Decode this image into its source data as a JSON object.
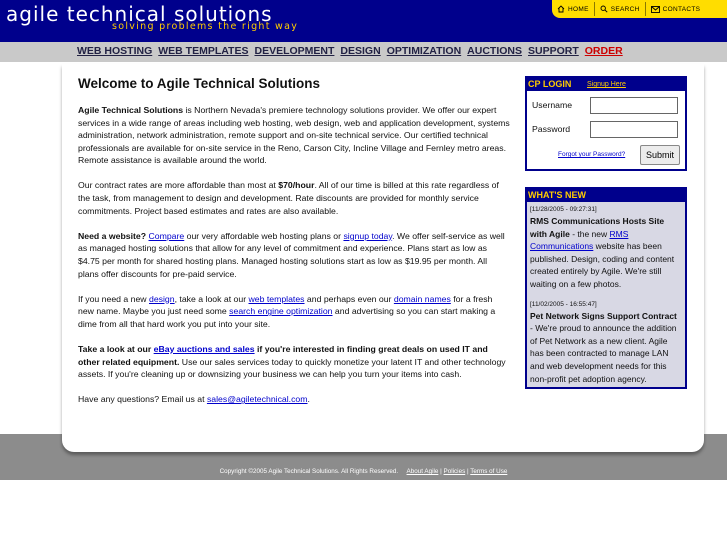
{
  "header": {
    "title": "agile technical solutions",
    "tagline": "solving problems the right way",
    "toplinks": [
      {
        "label": "Home",
        "icon": "home-icon"
      },
      {
        "label": "Search",
        "icon": "search-icon"
      },
      {
        "label": "Contacts",
        "icon": "mail-icon"
      }
    ]
  },
  "nav": [
    "WEB HOSTING",
    "WEB TEMPLATES",
    "DEVELOPMENT",
    "DESIGN",
    "OPTIMIZATION",
    "AUCTIONS",
    "SUPPORT",
    "ORDER"
  ],
  "main": {
    "heading": "Welcome to Agile Technical Solutions",
    "p1": {
      "strong": "Agile Technical Solutions",
      "text": " is Northern Nevada's premiere technology solutions provider. We offer our expert services in a wide range of areas including web hosting, web design, web and application development, systems administration, network administration, remote support and on-site technical service. Our certified technical professionals are available for on-site service in the Reno, Carson City, Incline Village and Fernley metro areas. Remote assistance is available around the world."
    },
    "p2": {
      "a": "Our contract rates are more affordable than most at ",
      "rate": "$70/hour",
      "b": ". All of our time is billed at this rate regardless of the task, from management to design and development. Rate discounts are provided for monthly service commitments. Project based estimates and rates are also available."
    },
    "p3": {
      "lead": "Need a website?",
      "link1": "Compare",
      "t1": " our very affordable web hosting plans or ",
      "link2": "signup today",
      "t2": ". We offer self-service as well as managed hosting solutions that allow for any level of commitment and experience. Plans start as low as $4.75 per month for shared hosting plans. Managed hosting solutions start as low as $19.95 per month. All plans offer discounts for pre-paid service."
    },
    "p4": {
      "t1": "If you need a new ",
      "link1": "design",
      "t2": ", take a look at our ",
      "link2": "web templates",
      "t3": " and perhaps even our ",
      "link3": "domain names",
      "t4": " for a fresh new name. Maybe you just need some ",
      "link4": "search engine optimization",
      "t5": " and advertising so you can start making a dime from all that hard work you put into your site."
    },
    "p5": {
      "b1": "Take a look at our ",
      "link": "eBay auctions and sales",
      "b2": " if you're interested in finding great deals on used IT and other related equipment.",
      "t": " Use our sales services today to quickly monetize your latent IT and other technology assets. If you're cleaning up or downsizing your business we can help you turn your items into cash."
    },
    "p6": {
      "t": "Have any questions? Email us at ",
      "email": "sales@agiletechnical.com",
      "end": "."
    }
  },
  "cp": {
    "title": "CP LOGIN",
    "signup": "Signup Here",
    "username_label": "Username",
    "password_label": "Password",
    "username_value": "",
    "password_value": "",
    "forgot": "Forgot your Password?",
    "submit": "Submit"
  },
  "news": {
    "title": "WHAT'S NEW",
    "items": [
      {
        "date": "[11/28/2005 - 09:27:31]",
        "headline": "RMS Communications Hosts Site with Agile",
        "t1": " - the new ",
        "link": "RMS Communications",
        "t2": " website has been published. Design, coding and content created entirely by Agile. We're still waiting on a few photos."
      },
      {
        "date": "[11/02/2005 - 16:55:47]",
        "headline": "Pet Network Signs Support Contract",
        "t1": " - We're proud to announce the addition of Pet Network as a new client. Agile has been contracted to manage LAN and web development needs for this non-profit pet adoption agency."
      }
    ]
  },
  "footer": {
    "copyright": "Copyright ©2005 Agile Technical Solutions. All Rights Reserved.",
    "links": [
      "About Agile",
      "Policies",
      "Terms of Use"
    ]
  },
  "colors": {
    "header_bg": "#00008c",
    "accent_yellow": "#ffcc00",
    "nav_bg": "#c9c9c9",
    "link": "#0000cc",
    "order": "#cc0000"
  }
}
